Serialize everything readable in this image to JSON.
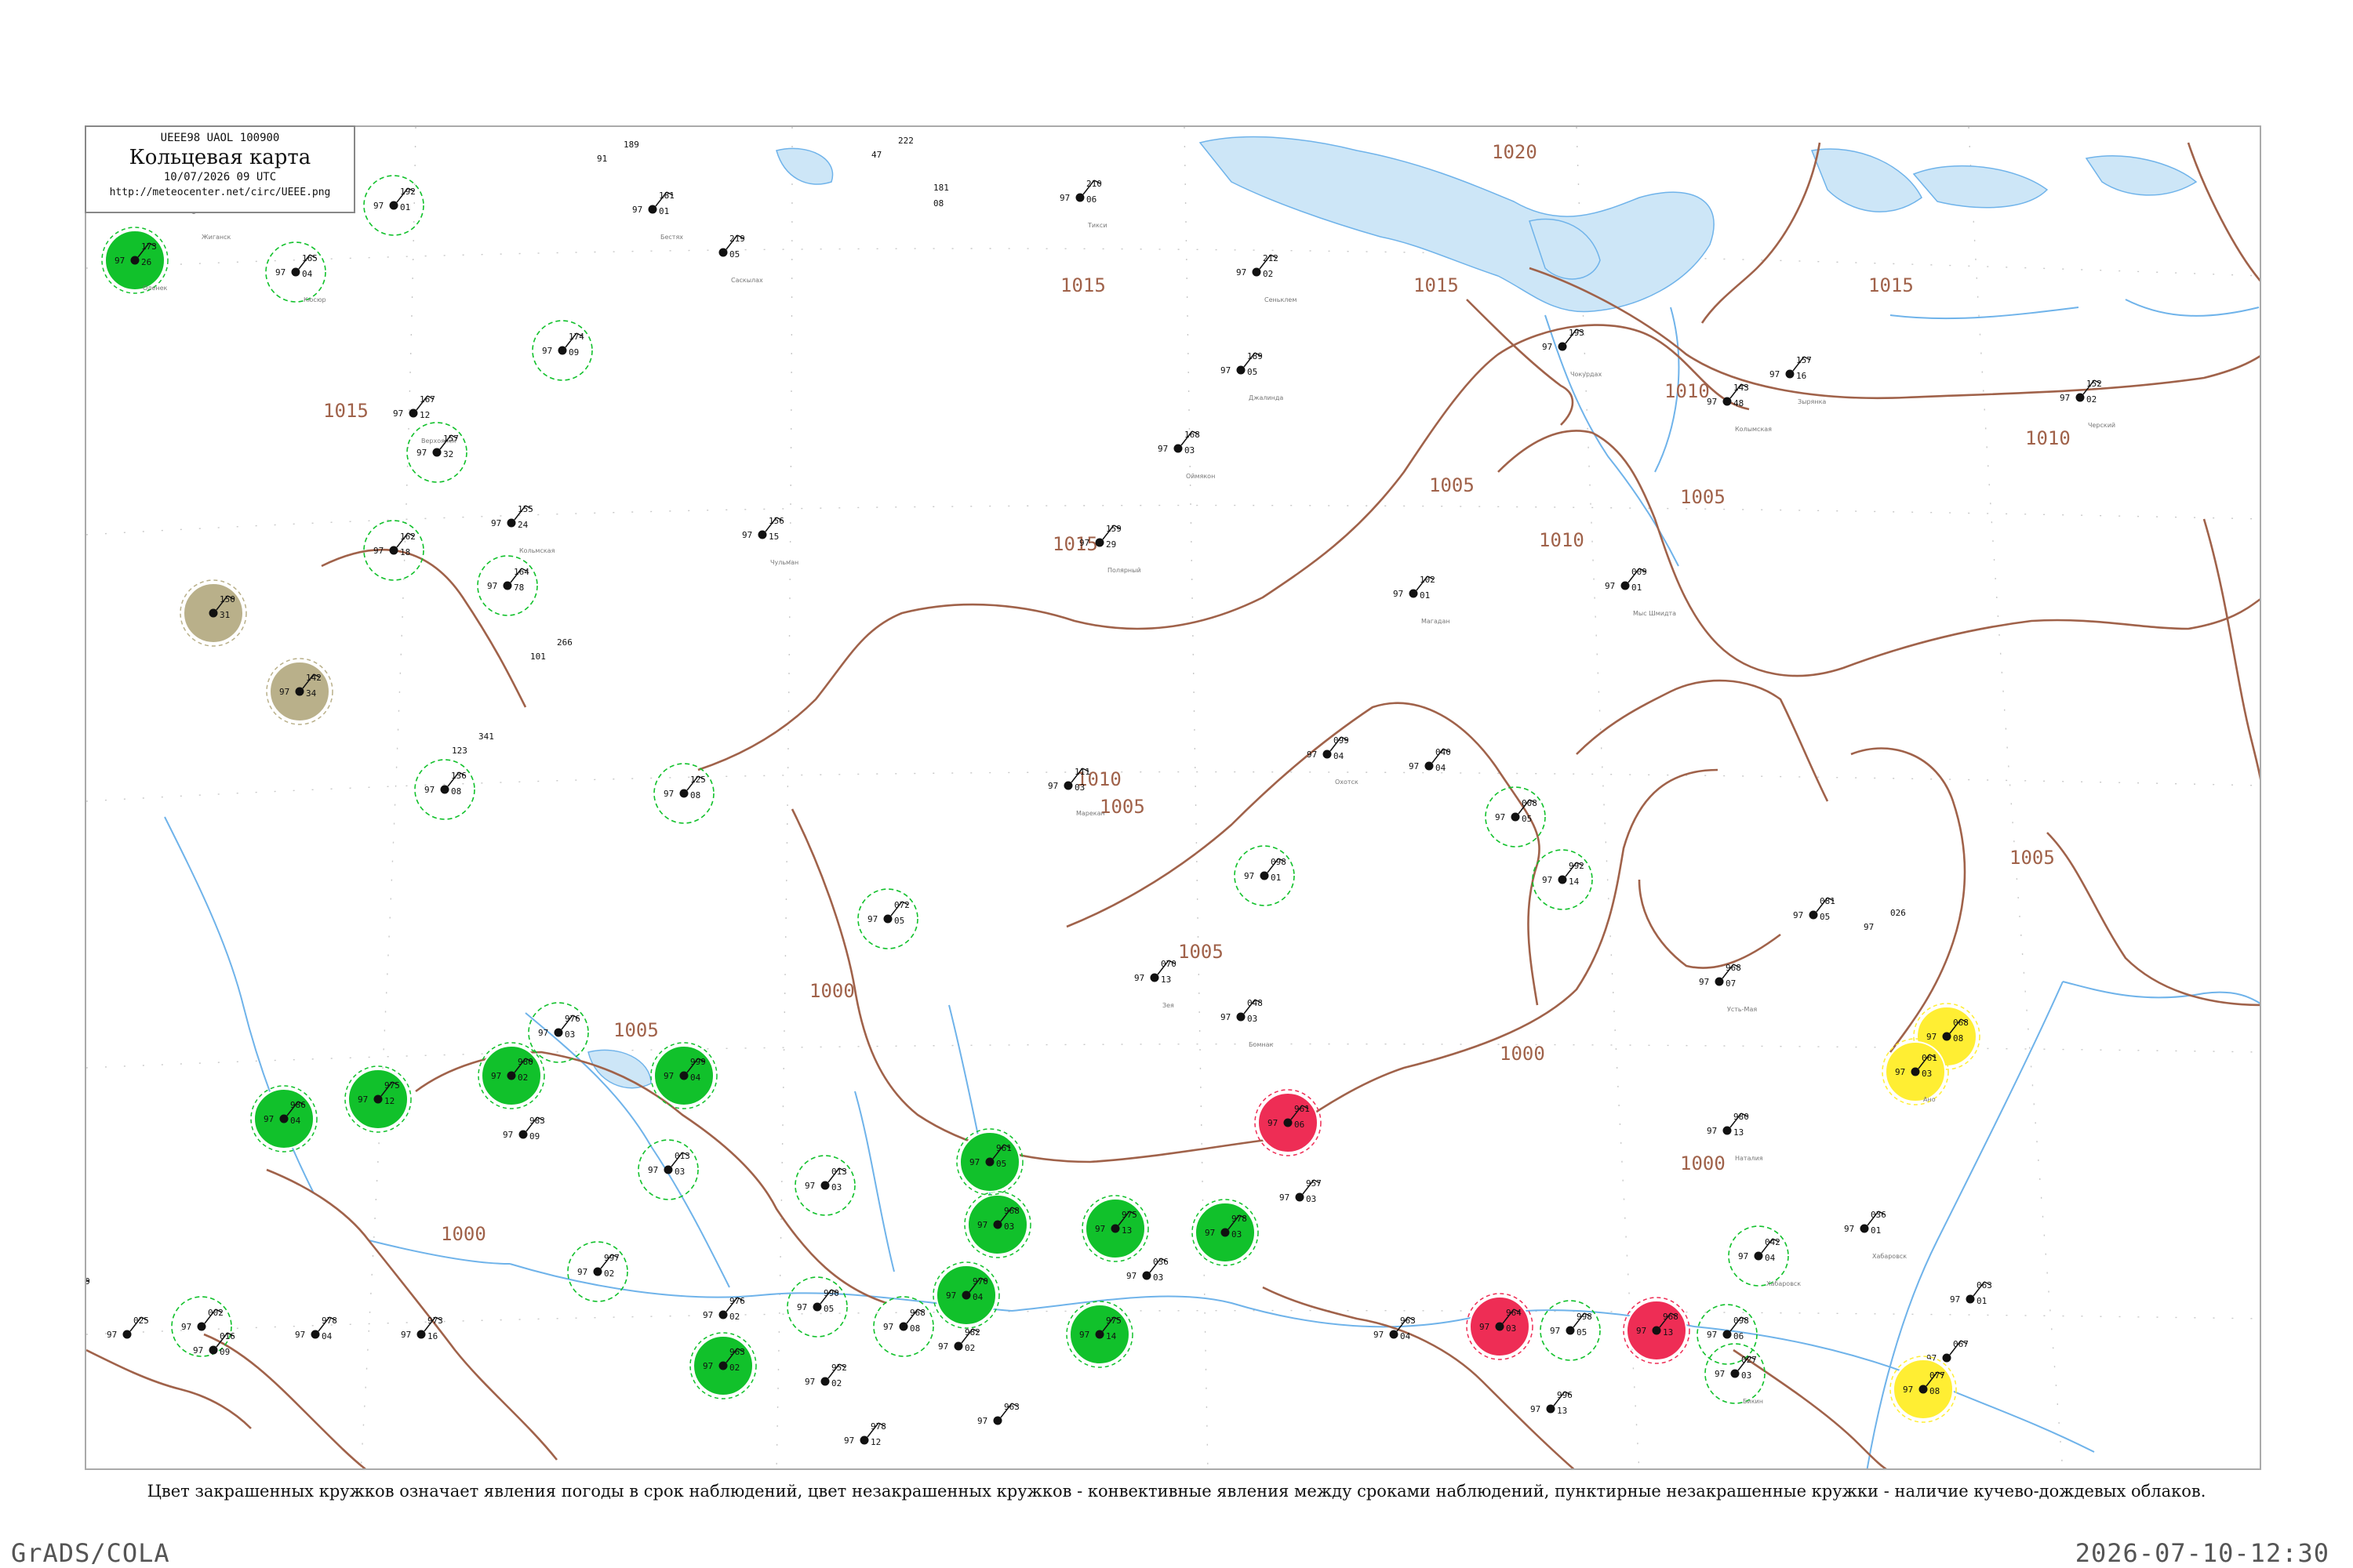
{
  "legend": {
    "code": "UEEE98  UAOL  100900",
    "title": "Кольцевая карта",
    "time": "10/07/2026 09 UTC",
    "url": "http://meteocenter.net/circ/UEEE.png"
  },
  "caption": "Цвет закрашенных кружков означает явления погоды в срок наблюдений, цвет незакрашенных кружков - конвективные явления между сроками наблюдений, пунктирные незакрашенные кружки - наличие кучево-дождевых облаков.",
  "footer": {
    "software": "GrADS/COLA",
    "timestamp": "2026-07-10-12:30"
  },
  "colors": {
    "rain": "#11c12b",
    "thunder": "#ee2d55",
    "dust": "#b9b08a",
    "fog": "#ffee33",
    "isobar": "#a0624a",
    "water": "#6fb3ea"
  },
  "isobar_labels": [
    "1020",
    "1015",
    "1015",
    "1015",
    "1015",
    "1015",
    "1010",
    "1010",
    "1010",
    "1010",
    "1005",
    "1005",
    "1005",
    "1005",
    "1005",
    "1005",
    "1000",
    "1000",
    "1000",
    "1000"
  ],
  "stations": [
    {
      "pressure": "199",
      "temp": "97",
      "dew": "03",
      "name": "Кюсюр-Сиен",
      "status": "open"
    },
    {
      "pressure": "118",
      "temp": "",
      "dew": "",
      "name": "Жиганск",
      "status": "open"
    },
    {
      "pressure": "189",
      "temp": "91",
      "dew": "",
      "name": "",
      "status": "plain"
    },
    {
      "pressure": "181",
      "temp": "97",
      "dew": "01",
      "name": "Бестях",
      "status": "open"
    },
    {
      "pressure": "222",
      "temp": "47",
      "dew": "",
      "name": "",
      "status": "plain"
    },
    {
      "pressure": "181",
      "temp": "",
      "dew": "08",
      "name": "",
      "status": "plain"
    },
    {
      "pressure": "210",
      "temp": "97",
      "dew": "06",
      "name": "Тикси",
      "status": "open"
    },
    {
      "pressure": "173",
      "temp": "97",
      "dew": "26",
      "name": "Оленек",
      "status": "rain"
    },
    {
      "pressure": "192",
      "temp": "97",
      "dew": "01",
      "name": "",
      "status": "cb"
    },
    {
      "pressure": "165",
      "temp": "97",
      "dew": "04",
      "name": "Кюсюр",
      "status": "cb"
    },
    {
      "pressure": "219",
      "temp": "",
      "dew": "05",
      "name": "Саскылах",
      "status": "open"
    },
    {
      "pressure": "212",
      "temp": "97",
      "dew": "02",
      "name": "Сеньклем",
      "status": "open"
    },
    {
      "pressure": "174",
      "temp": "97",
      "dew": "09",
      "name": "",
      "status": "cb"
    },
    {
      "pressure": "167",
      "temp": "97",
      "dew": "12",
      "name": "Верхоянск",
      "status": "open"
    },
    {
      "pressure": "189",
      "temp": "97",
      "dew": "05",
      "name": "Джалинда",
      "status": "open"
    },
    {
      "pressure": "193",
      "temp": "97",
      "dew": "",
      "name": "Чокурдах",
      "status": "open"
    },
    {
      "pressure": "157",
      "temp": "97",
      "dew": "16",
      "name": "Зырянка",
      "status": "open"
    },
    {
      "pressure": "143",
      "temp": "97",
      "dew": "48",
      "name": "Колымская",
      "status": "open"
    },
    {
      "pressure": "152",
      "temp": "97",
      "dew": "02",
      "name": "Черский",
      "status": "open"
    },
    {
      "pressure": "157",
      "temp": "97",
      "dew": "32",
      "name": "",
      "status": "cb"
    },
    {
      "pressure": "168",
      "temp": "97",
      "dew": "03",
      "name": "Оймякон",
      "status": "open"
    },
    {
      "pressure": "155",
      "temp": "97",
      "dew": "24",
      "name": "Кольмская",
      "status": "open"
    },
    {
      "pressure": "162",
      "temp": "97",
      "dew": "18",
      "name": "",
      "status": "cb"
    },
    {
      "pressure": "159",
      "temp": "97",
      "dew": "29",
      "name": "Полярный",
      "status": "open"
    },
    {
      "pressure": "164",
      "temp": "97",
      "dew": "78",
      "name": "",
      "status": "cb"
    },
    {
      "pressure": "156",
      "temp": "97",
      "dew": "15",
      "name": "Чульман",
      "status": "open"
    },
    {
      "pressure": "009",
      "temp": "97",
      "dew": "01",
      "name": "Мыс Шмидта",
      "status": "open"
    },
    {
      "pressure": "102",
      "temp": "97",
      "dew": "01",
      "name": "Магадан",
      "status": "open"
    },
    {
      "pressure": "150",
      "temp": "",
      "dew": "31",
      "name": "",
      "status": "dust"
    },
    {
      "pressure": "142",
      "temp": "97",
      "dew": "34",
      "name": "",
      "status": "dust"
    },
    {
      "pressure": "266",
      "temp": "101",
      "dew": "",
      "name": "",
      "status": "plain"
    },
    {
      "pressure": "341",
      "temp": "123",
      "dew": "",
      "name": "",
      "status": "plain"
    },
    {
      "pressure": "136",
      "temp": "97",
      "dew": "08",
      "name": "",
      "status": "cb"
    },
    {
      "pressure": "125",
      "temp": "97",
      "dew": "08",
      "name": "",
      "status": "cb"
    },
    {
      "pressure": "111",
      "temp": "97",
      "dew": "03",
      "name": "Марекан",
      "status": "open"
    },
    {
      "pressure": "099",
      "temp": "97",
      "dew": "04",
      "name": "Охотск",
      "status": "open"
    },
    {
      "pressure": "040",
      "temp": "97",
      "dew": "04",
      "name": "",
      "status": "open"
    },
    {
      "pressure": "008",
      "temp": "97",
      "dew": "05",
      "name": "",
      "status": "cb"
    },
    {
      "pressure": "098",
      "temp": "97",
      "dew": "01",
      "name": "",
      "status": "cb"
    },
    {
      "pressure": "072",
      "temp": "97",
      "dew": "05",
      "name": "",
      "status": "cb"
    },
    {
      "pressure": "070",
      "temp": "97",
      "dew": "13",
      "name": "Зея",
      "status": "open"
    },
    {
      "pressure": "048",
      "temp": "97",
      "dew": "03",
      "name": "Бомнак",
      "status": "open"
    },
    {
      "pressure": "968",
      "temp": "97",
      "dew": "07",
      "name": "Усть-Мая",
      "status": "open"
    },
    {
      "pressure": "992",
      "temp": "97",
      "dew": "14",
      "name": "",
      "status": "cb"
    },
    {
      "pressure": "026",
      "temp": "97",
      "dew": "",
      "name": "",
      "status": "plain"
    },
    {
      "pressure": "081",
      "temp": "97",
      "dew": "05",
      "name": "",
      "status": "open"
    },
    {
      "pressure": "068",
      "temp": "97",
      "dew": "08",
      "name": "",
      "status": "fog"
    },
    {
      "pressure": "061",
      "temp": "97",
      "dew": "03",
      "name": "Ано",
      "status": "fog"
    },
    {
      "pressure": "980",
      "temp": "97",
      "dew": "13",
      "name": "Наталия",
      "status": "open"
    },
    {
      "pressure": "036",
      "temp": "97",
      "dew": "01",
      "name": "Хабаровск",
      "status": "open"
    },
    {
      "pressure": "063",
      "temp": "97",
      "dew": "01",
      "name": "",
      "status": "open"
    },
    {
      "pressure": "067",
      "temp": "97",
      "dew": "",
      "name": "",
      "status": "open"
    },
    {
      "pressure": "077",
      "temp": "97",
      "dew": "08",
      "name": "",
      "status": "fog"
    },
    {
      "pressure": "098",
      "temp": "97",
      "dew": "06",
      "name": "",
      "status": "cb"
    },
    {
      "pressure": "027",
      "temp": "97",
      "dew": "03",
      "name": "Бикин",
      "status": "cb"
    },
    {
      "pressure": "996",
      "temp": "97",
      "dew": "13",
      "name": "",
      "status": "open"
    },
    {
      "pressure": "963",
      "temp": "97",
      "dew": "04",
      "name": "",
      "status": "open"
    },
    {
      "pressure": "957",
      "temp": "97",
      "dew": "03",
      "name": "",
      "status": "open"
    },
    {
      "pressure": "978",
      "temp": "97",
      "dew": "03",
      "name": "",
      "status": "rain"
    },
    {
      "pressure": "975",
      "temp": "97",
      "dew": "13",
      "name": "",
      "status": "rain"
    },
    {
      "pressure": "990",
      "temp": "97",
      "dew": "05",
      "name": "",
      "status": "cb"
    },
    {
      "pressure": "997",
      "temp": "97",
      "dew": "02",
      "name": "",
      "status": "cb"
    },
    {
      "pressure": "983",
      "temp": "97",
      "dew": "09",
      "name": "",
      "status": "open"
    },
    {
      "pressure": "976",
      "temp": "97",
      "dew": "03",
      "name": "",
      "status": "cb"
    },
    {
      "pressure": "013",
      "temp": "97",
      "dew": "03",
      "name": "",
      "status": "cb"
    },
    {
      "pressure": "976",
      "temp": "97",
      "dew": "02",
      "name": "",
      "status": "open"
    },
    {
      "pressure": "963",
      "temp": "97",
      "dew": "02",
      "name": "",
      "status": "rain"
    },
    {
      "pressure": "968",
      "temp": "97",
      "dew": "08",
      "name": "",
      "status": "cb"
    },
    {
      "pressure": "982",
      "temp": "97",
      "dew": "02",
      "name": "",
      "status": "open"
    },
    {
      "pressure": "963",
      "temp": "97",
      "dew": "",
      "name": "",
      "status": "open"
    },
    {
      "pressure": "036",
      "temp": "97",
      "dew": "03",
      "name": "",
      "status": "open"
    },
    {
      "pressure": "002",
      "temp": "97",
      "dew": "",
      "name": "",
      "status": "cb"
    },
    {
      "pressure": "016",
      "temp": "97",
      "dew": "09",
      "name": "",
      "status": "open"
    },
    {
      "pressure": "039",
      "temp": "97",
      "dew": "02",
      "name": "",
      "status": "open"
    },
    {
      "pressure": "978",
      "temp": "97",
      "dew": "04",
      "name": "",
      "status": "open"
    },
    {
      "pressure": "025",
      "temp": "97",
      "dew": "",
      "name": "",
      "status": "open"
    },
    {
      "pressure": "973",
      "temp": "97",
      "dew": "16",
      "name": "",
      "status": "open"
    },
    {
      "pressure": "978",
      "temp": "97",
      "dew": "12",
      "name": "",
      "status": "open"
    },
    {
      "pressure": "952",
      "temp": "97",
      "dew": "02",
      "name": "",
      "status": "open"
    },
    {
      "pressure": "013",
      "temp": "97",
      "dew": "03",
      "name": "",
      "status": "cb"
    },
    {
      "pressure": "042",
      "temp": "97",
      "dew": "04",
      "name": "Хабаровск",
      "status": "cb"
    },
    {
      "pressure": "961",
      "temp": "97",
      "dew": "06",
      "name": "",
      "status": "thunder"
    },
    {
      "pressure": "964",
      "temp": "97",
      "dew": "03",
      "name": "",
      "status": "thunder"
    },
    {
      "pressure": "968",
      "temp": "97",
      "dew": "13",
      "name": "",
      "status": "thunder"
    },
    {
      "pressure": "998",
      "temp": "97",
      "dew": "05",
      "name": "",
      "status": "cb"
    },
    {
      "pressure": "970",
      "temp": "97",
      "dew": "04",
      "name": "",
      "status": "rain"
    },
    {
      "pressure": "968",
      "temp": "97",
      "dew": "03",
      "name": "",
      "status": "rain"
    },
    {
      "pressure": "975",
      "temp": "97",
      "dew": "14",
      "name": "",
      "status": "rain"
    },
    {
      "pressure": "961",
      "temp": "97",
      "dew": "05",
      "name": "",
      "status": "rain"
    },
    {
      "pressure": "999",
      "temp": "97",
      "dew": "04",
      "name": "",
      "status": "rain"
    },
    {
      "pressure": "975",
      "temp": "97",
      "dew": "12",
      "name": "",
      "status": "rain"
    },
    {
      "pressure": "986",
      "temp": "97",
      "dew": "04",
      "name": "",
      "status": "rain"
    },
    {
      "pressure": "980",
      "temp": "97",
      "dew": "02",
      "name": "",
      "status": "rain"
    }
  ]
}
